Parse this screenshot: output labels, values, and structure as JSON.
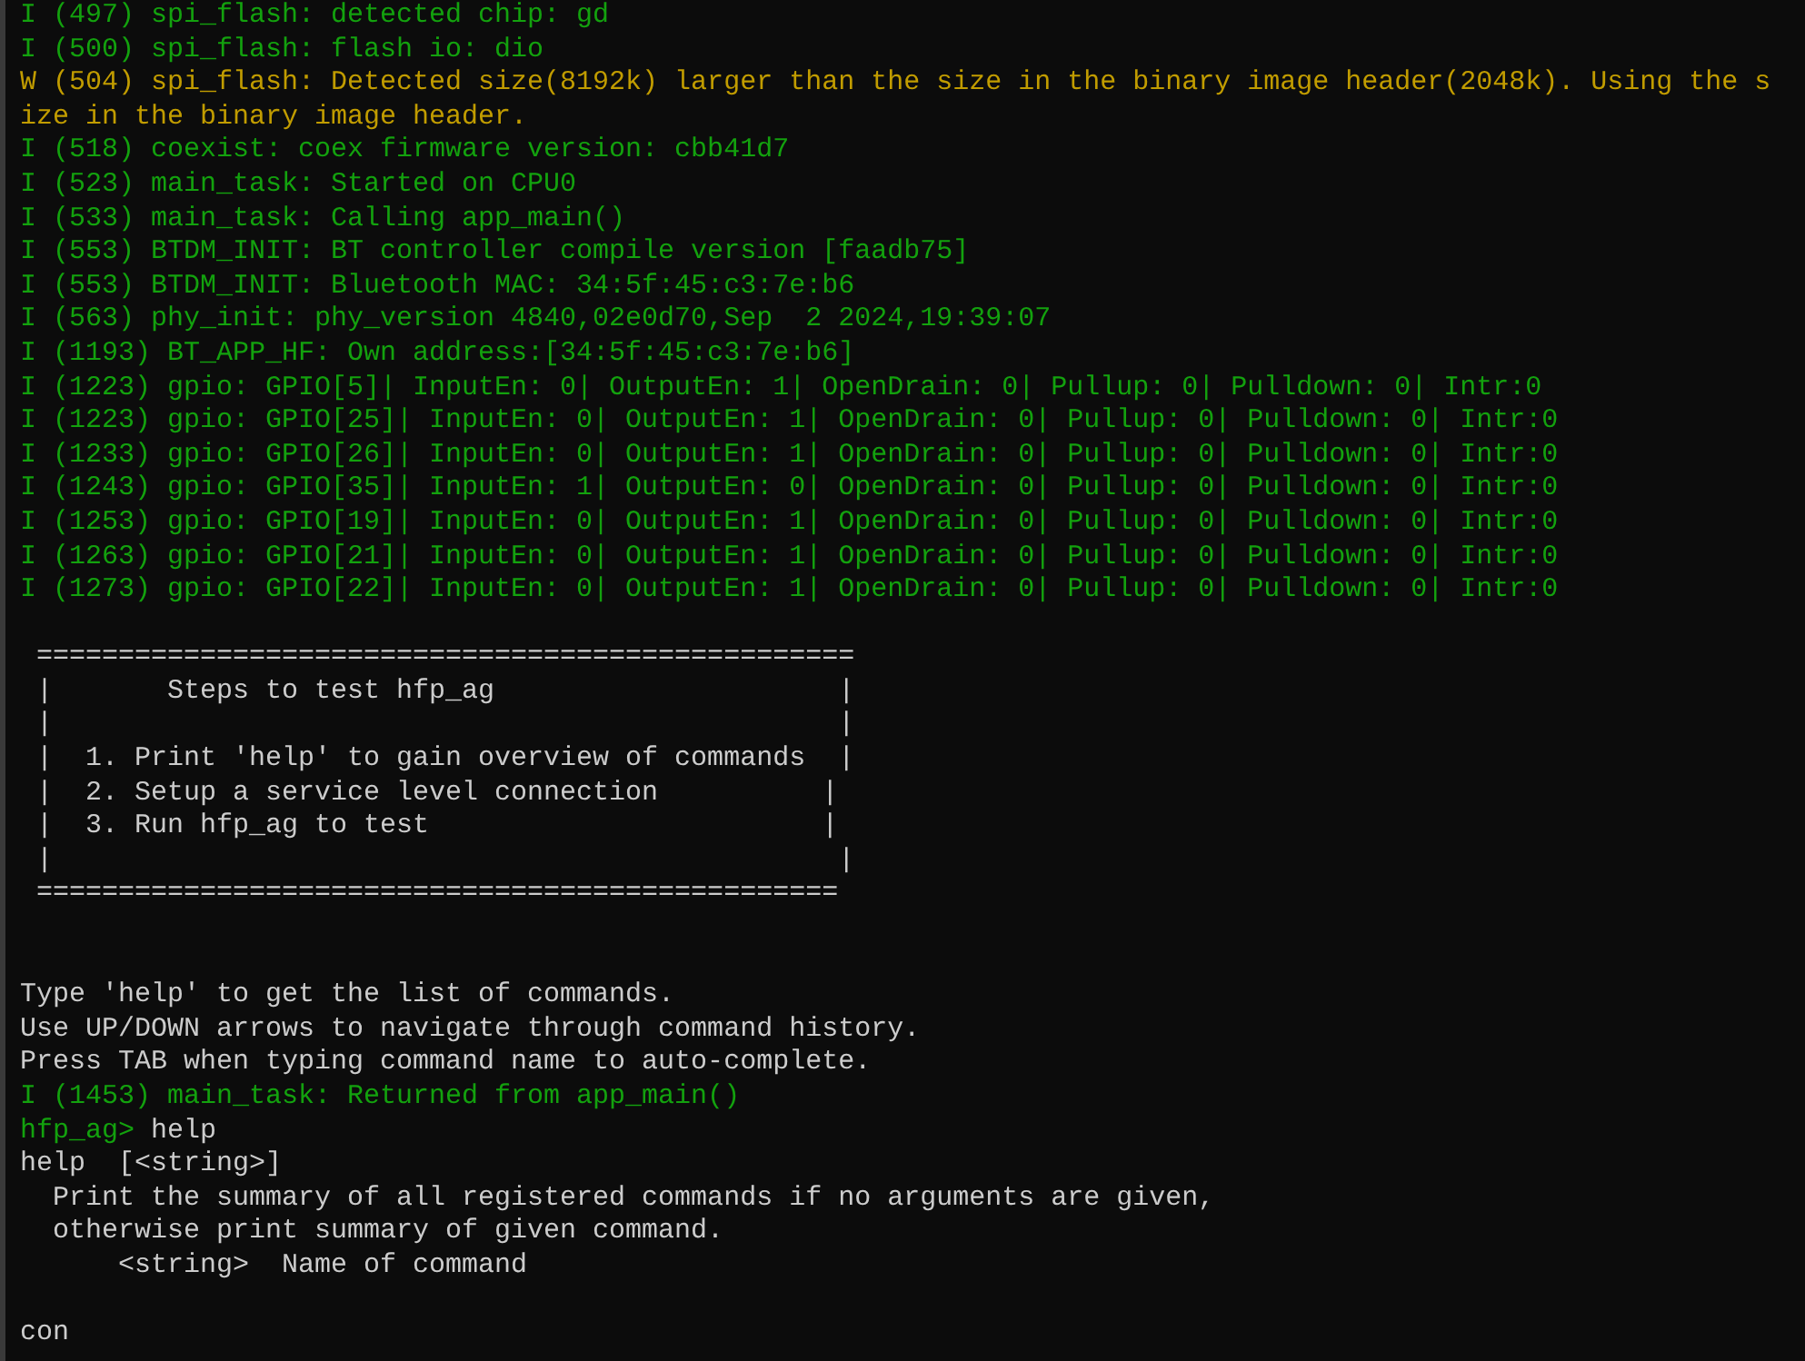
{
  "terminal": {
    "lines": [
      {
        "kind": "info",
        "text": "I (497) spi_flash: detected chip: gd"
      },
      {
        "kind": "info",
        "text": "I (500) spi_flash: flash io: dio"
      },
      {
        "kind": "warning",
        "text": "W (504) spi_flash: Detected size(8192k) larger than the size in the binary image header(2048k). Using the s"
      },
      {
        "kind": "warning",
        "text": "ize in the binary image header."
      },
      {
        "kind": "info",
        "text": "I (518) coexist: coex firmware version: cbb41d7"
      },
      {
        "kind": "info",
        "text": "I (523) main_task: Started on CPU0"
      },
      {
        "kind": "info",
        "text": "I (533) main_task: Calling app_main()"
      },
      {
        "kind": "info",
        "text": "I (553) BTDM_INIT: BT controller compile version [faadb75]"
      },
      {
        "kind": "info",
        "text": "I (553) BTDM_INIT: Bluetooth MAC: 34:5f:45:c3:7e:b6"
      },
      {
        "kind": "info",
        "text": "I (563) phy_init: phy_version 4840,02e0d70,Sep  2 2024,19:39:07"
      },
      {
        "kind": "info",
        "text": "I (1193) BT_APP_HF: Own address:[34:5f:45:c3:7e:b6]"
      },
      {
        "kind": "info",
        "text": "I (1223) gpio: GPIO[5]| InputEn: 0| OutputEn: 1| OpenDrain: 0| Pullup: 0| Pulldown: 0| Intr:0"
      },
      {
        "kind": "info",
        "text": "I (1223) gpio: GPIO[25]| InputEn: 0| OutputEn: 1| OpenDrain: 0| Pullup: 0| Pulldown: 0| Intr:0"
      },
      {
        "kind": "info",
        "text": "I (1233) gpio: GPIO[26]| InputEn: 0| OutputEn: 1| OpenDrain: 0| Pullup: 0| Pulldown: 0| Intr:0"
      },
      {
        "kind": "info",
        "text": "I (1243) gpio: GPIO[35]| InputEn: 1| OutputEn: 0| OpenDrain: 0| Pullup: 0| Pulldown: 0| Intr:0"
      },
      {
        "kind": "info",
        "text": "I (1253) gpio: GPIO[19]| InputEn: 0| OutputEn: 1| OpenDrain: 0| Pullup: 0| Pulldown: 0| Intr:0"
      },
      {
        "kind": "info",
        "text": "I (1263) gpio: GPIO[21]| InputEn: 0| OutputEn: 1| OpenDrain: 0| Pullup: 0| Pulldown: 0| Intr:0"
      },
      {
        "kind": "info",
        "text": "I (1273) gpio: GPIO[22]| InputEn: 0| OutputEn: 1| OpenDrain: 0| Pullup: 0| Pulldown: 0| Intr:0"
      },
      {
        "kind": "blank"
      },
      {
        "kind": "plain",
        "text": " =================================================="
      },
      {
        "kind": "plain",
        "text": " |       Steps to test hfp_ag                     |"
      },
      {
        "kind": "plain",
        "text": " |                                                |"
      },
      {
        "kind": "plain",
        "text": " |  1. Print 'help' to gain overview of commands  |"
      },
      {
        "kind": "plain",
        "text": " |  2. Setup a service level connection          |"
      },
      {
        "kind": "plain",
        "text": " |  3. Run hfp_ag to test                        |"
      },
      {
        "kind": "plain",
        "text": " |                                                |"
      },
      {
        "kind": "plain",
        "text": " ================================================="
      },
      {
        "kind": "blank"
      },
      {
        "kind": "blank"
      },
      {
        "kind": "plain",
        "text": "Type 'help' to get the list of commands."
      },
      {
        "kind": "plain",
        "text": "Use UP/DOWN arrows to navigate through command history."
      },
      {
        "kind": "plain",
        "text": "Press TAB when typing command name to auto-complete."
      },
      {
        "kind": "info",
        "text": "I (1453) main_task: Returned from app_main()"
      },
      {
        "kind": "prompt",
        "prompt": "hfp_ag>",
        "command": "help"
      },
      {
        "kind": "plain",
        "text": "help  [<string>]"
      },
      {
        "kind": "plain",
        "text": "  Print the summary of all registered commands if no arguments are given,"
      },
      {
        "kind": "plain",
        "text": "  otherwise print summary of given command."
      },
      {
        "kind": "plain",
        "text": "      <string>  Name of command"
      },
      {
        "kind": "blank"
      },
      {
        "kind": "plain",
        "text": "con"
      }
    ]
  }
}
